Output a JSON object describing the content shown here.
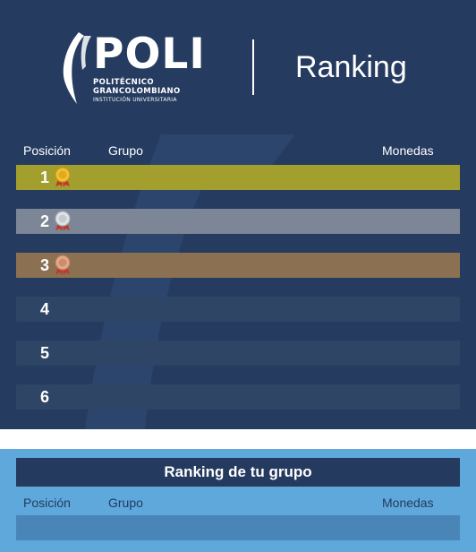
{
  "header": {
    "logo_word": "POLI",
    "logo_line1": "POLITÉCNICO",
    "logo_line2": "GRANCOLOMBIANO",
    "logo_line3": "INSTITUCIÓN UNIVERSITARIA",
    "title": "Ranking"
  },
  "table": {
    "col_position": "Posición",
    "col_group": "Grupo",
    "col_coins": "Monedas"
  },
  "rows": [
    {
      "rank": "1",
      "medal": "gold-medal-icon",
      "color": "#a39f2f"
    },
    {
      "rank": "2",
      "medal": "silver-medal-icon",
      "color": "#7c8696"
    },
    {
      "rank": "3",
      "medal": "bronze-medal-icon",
      "color": "#8b7151"
    },
    {
      "rank": "4",
      "color": "#2f4565"
    },
    {
      "rank": "5",
      "color": "#2f4565"
    },
    {
      "rank": "6",
      "color": "#2f4565"
    }
  ],
  "group_section": {
    "title": "Ranking de tu grupo",
    "col_position": "Posición",
    "col_group": "Grupo",
    "col_coins": "Monedas"
  },
  "colors": {
    "navy": "#253b60",
    "light_blue": "#5fa8dc",
    "gold": "#a39f2f",
    "silver": "#7c8696",
    "bronze": "#8b7151"
  }
}
